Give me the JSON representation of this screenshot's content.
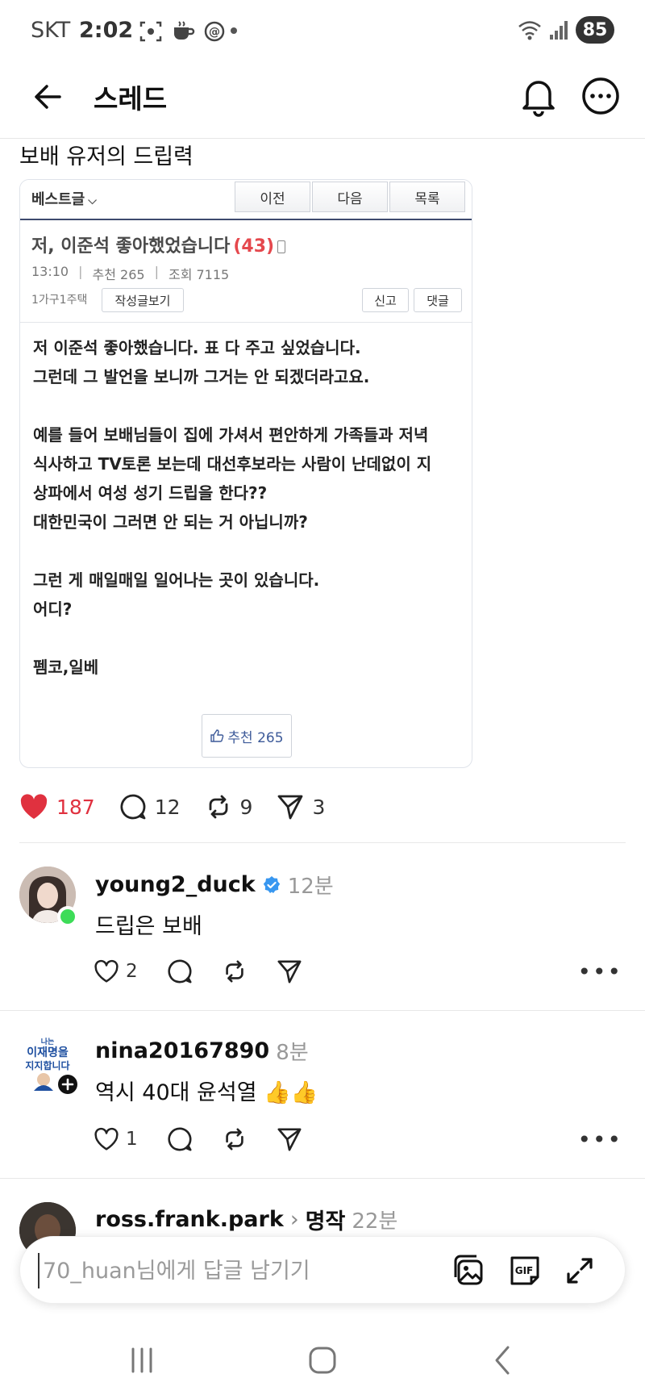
{
  "status": {
    "carrier": "SKT",
    "time": "2:02",
    "battery": "85"
  },
  "header": {
    "title": "스레드"
  },
  "post": {
    "text": "보배 유저의 드립력",
    "card": {
      "best_label": "베스트글",
      "nav_buttons": [
        "이전",
        "다음",
        "목록"
      ],
      "title": "저, 이준석 좋아했었습니다",
      "comment_count": "(43)",
      "meta_time": "13:10",
      "meta_recommend": "추천 265",
      "meta_views": "조회 7115",
      "writer": "1가구1주택",
      "writer_posts_button": "작성글보기",
      "report_button": "신고",
      "reply_button": "댓글",
      "body_lines": [
        "저 이준석 좋아했습니다. 표 다 주고 싶었습니다.",
        "그런데 그 발언을 보니까 그거는 안 되겠더라고요.",
        "",
        "예를 들어 보배님들이 집에 가셔서 편안하게 가족들과 저녁",
        "식사하고 TV토론 보는데 대선후보라는 사람이 난데없이 지",
        "상파에서 여성 성기 드립을 한다??",
        "대한민국이 그러면 안 되는 거 아닙니까?",
        "",
        "그런 게 매일매일 일어나는 곳이 있습니다.",
        "어디?",
        "",
        "펨코,일베"
      ],
      "recommend_button": "추천 265"
    },
    "likes": "187",
    "comments": "12",
    "reposts": "9",
    "shares": "3"
  },
  "comments": [
    {
      "username": "young2_duck",
      "time": "12분",
      "text": "드립은 보배",
      "likes": "2"
    },
    {
      "username": "nina20167890",
      "time": "8분",
      "text": "역시 40대 윤석열 👍👍",
      "likes": "1",
      "avatar_text": [
        "나는",
        "이재명을",
        "지지합니다"
      ]
    },
    {
      "username": "ross.frank.park",
      "reply_to": "명작",
      "time": "22분"
    }
  ],
  "reply_bar": {
    "placeholder": "70_huan님에게 답글 남기기",
    "gif_label": "GIF"
  },
  "colors": {
    "like_red": "#e0313f",
    "verified_blue": "#3897f0",
    "online_green": "#3ddc58"
  }
}
